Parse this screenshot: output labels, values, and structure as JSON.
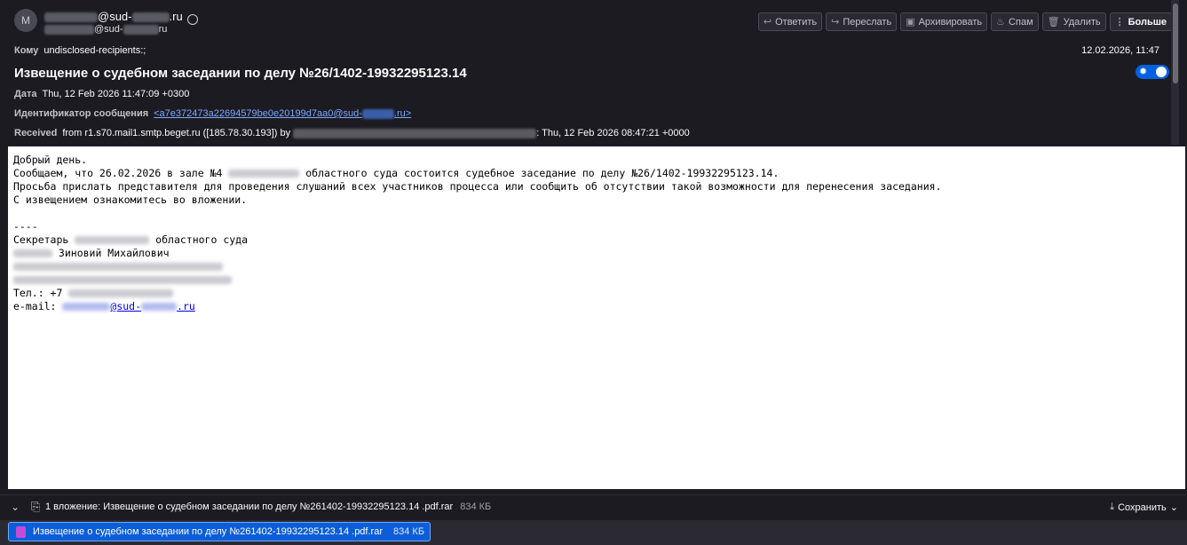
{
  "header": {
    "avatar_letter": "M",
    "from_domain": "@sud-",
    "from_tld": ".ru",
    "from_sub_domain": "@sud-",
    "from_sub_tld": "ru",
    "toolbar": {
      "reply": "Ответить",
      "forward": "Переслать",
      "archive": "Архивировать",
      "spam": "Спам",
      "delete": "Удалить",
      "more": "Больше"
    },
    "to_label": "Кому",
    "to_value": "undisclosed-recipients:;",
    "date_right": "12.02.2026, 11:47",
    "subject": "Извещение о судебном заседании по делу №26/1402-19932295123.14",
    "date_label": "Дата",
    "date_value": "Thu, 12 Feb 2026 11:47:09 +0300",
    "msgid_label": "Идентификатор сообщения",
    "msgid_prefix": "<a7e372473a22694579be0e20199d7aa0@sud-",
    "msgid_suffix": ".ru>",
    "received_label": "Received",
    "received_prefix": "from r1.s70.mail1.smtp.beget.ru ([185.78.30.193]) by",
    "received_suffix": ": Thu, 12 Feb 2026 08:47:21 +0000"
  },
  "body": {
    "greeting": "Добрый день.",
    "line1_a": "Сообщаем, что 26.02.2026 в зале №4 ",
    "line1_b": " областного суда состоится судебное заседание по делу №26/1402-19932295123.14.",
    "line2": "Просьба прислать представителя для проведения слушаний всех участников процесса или сообщить об отсутствии такой возможности для перенесения заседания.",
    "line3": "С извещением ознакомитесь во вложении.",
    "separator": "----",
    "sig_title_a": "Секретарь ",
    "sig_title_b": " областного суда",
    "sig_name": " Зиновий Михайлович",
    "phone_prefix": "Тел.: +7 ",
    "email_prefix": "e-mail: ",
    "email_domain": "@sud-",
    "email_tld": ".ru"
  },
  "attachments": {
    "summary": "1 вложение: Извещение о судебном заседании по делу №261402-19932295123.14 .pdf.rar",
    "size": "834 КБ",
    "save_label": "Сохранить",
    "file_name": "Извещение о судебном заседании по делу №261402-19932295123.14 .pdf.rar",
    "file_size": "834 КБ"
  }
}
